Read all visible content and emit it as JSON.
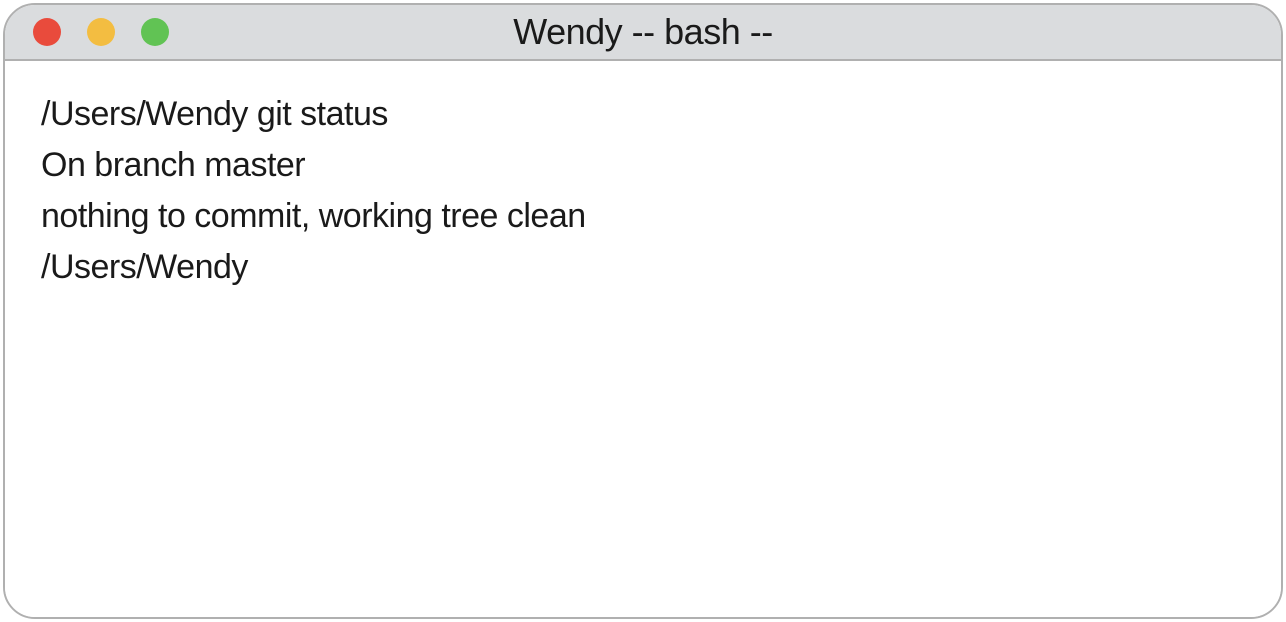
{
  "window": {
    "title": "Wendy -- bash --",
    "traffic_lights": {
      "red": "#e94b3c",
      "yellow": "#f3bd41",
      "green": "#61c354"
    }
  },
  "terminal": {
    "lines": [
      "/Users/Wendy git status",
      "On branch master",
      "nothing to commit, working tree clean",
      "/Users/Wendy"
    ]
  }
}
